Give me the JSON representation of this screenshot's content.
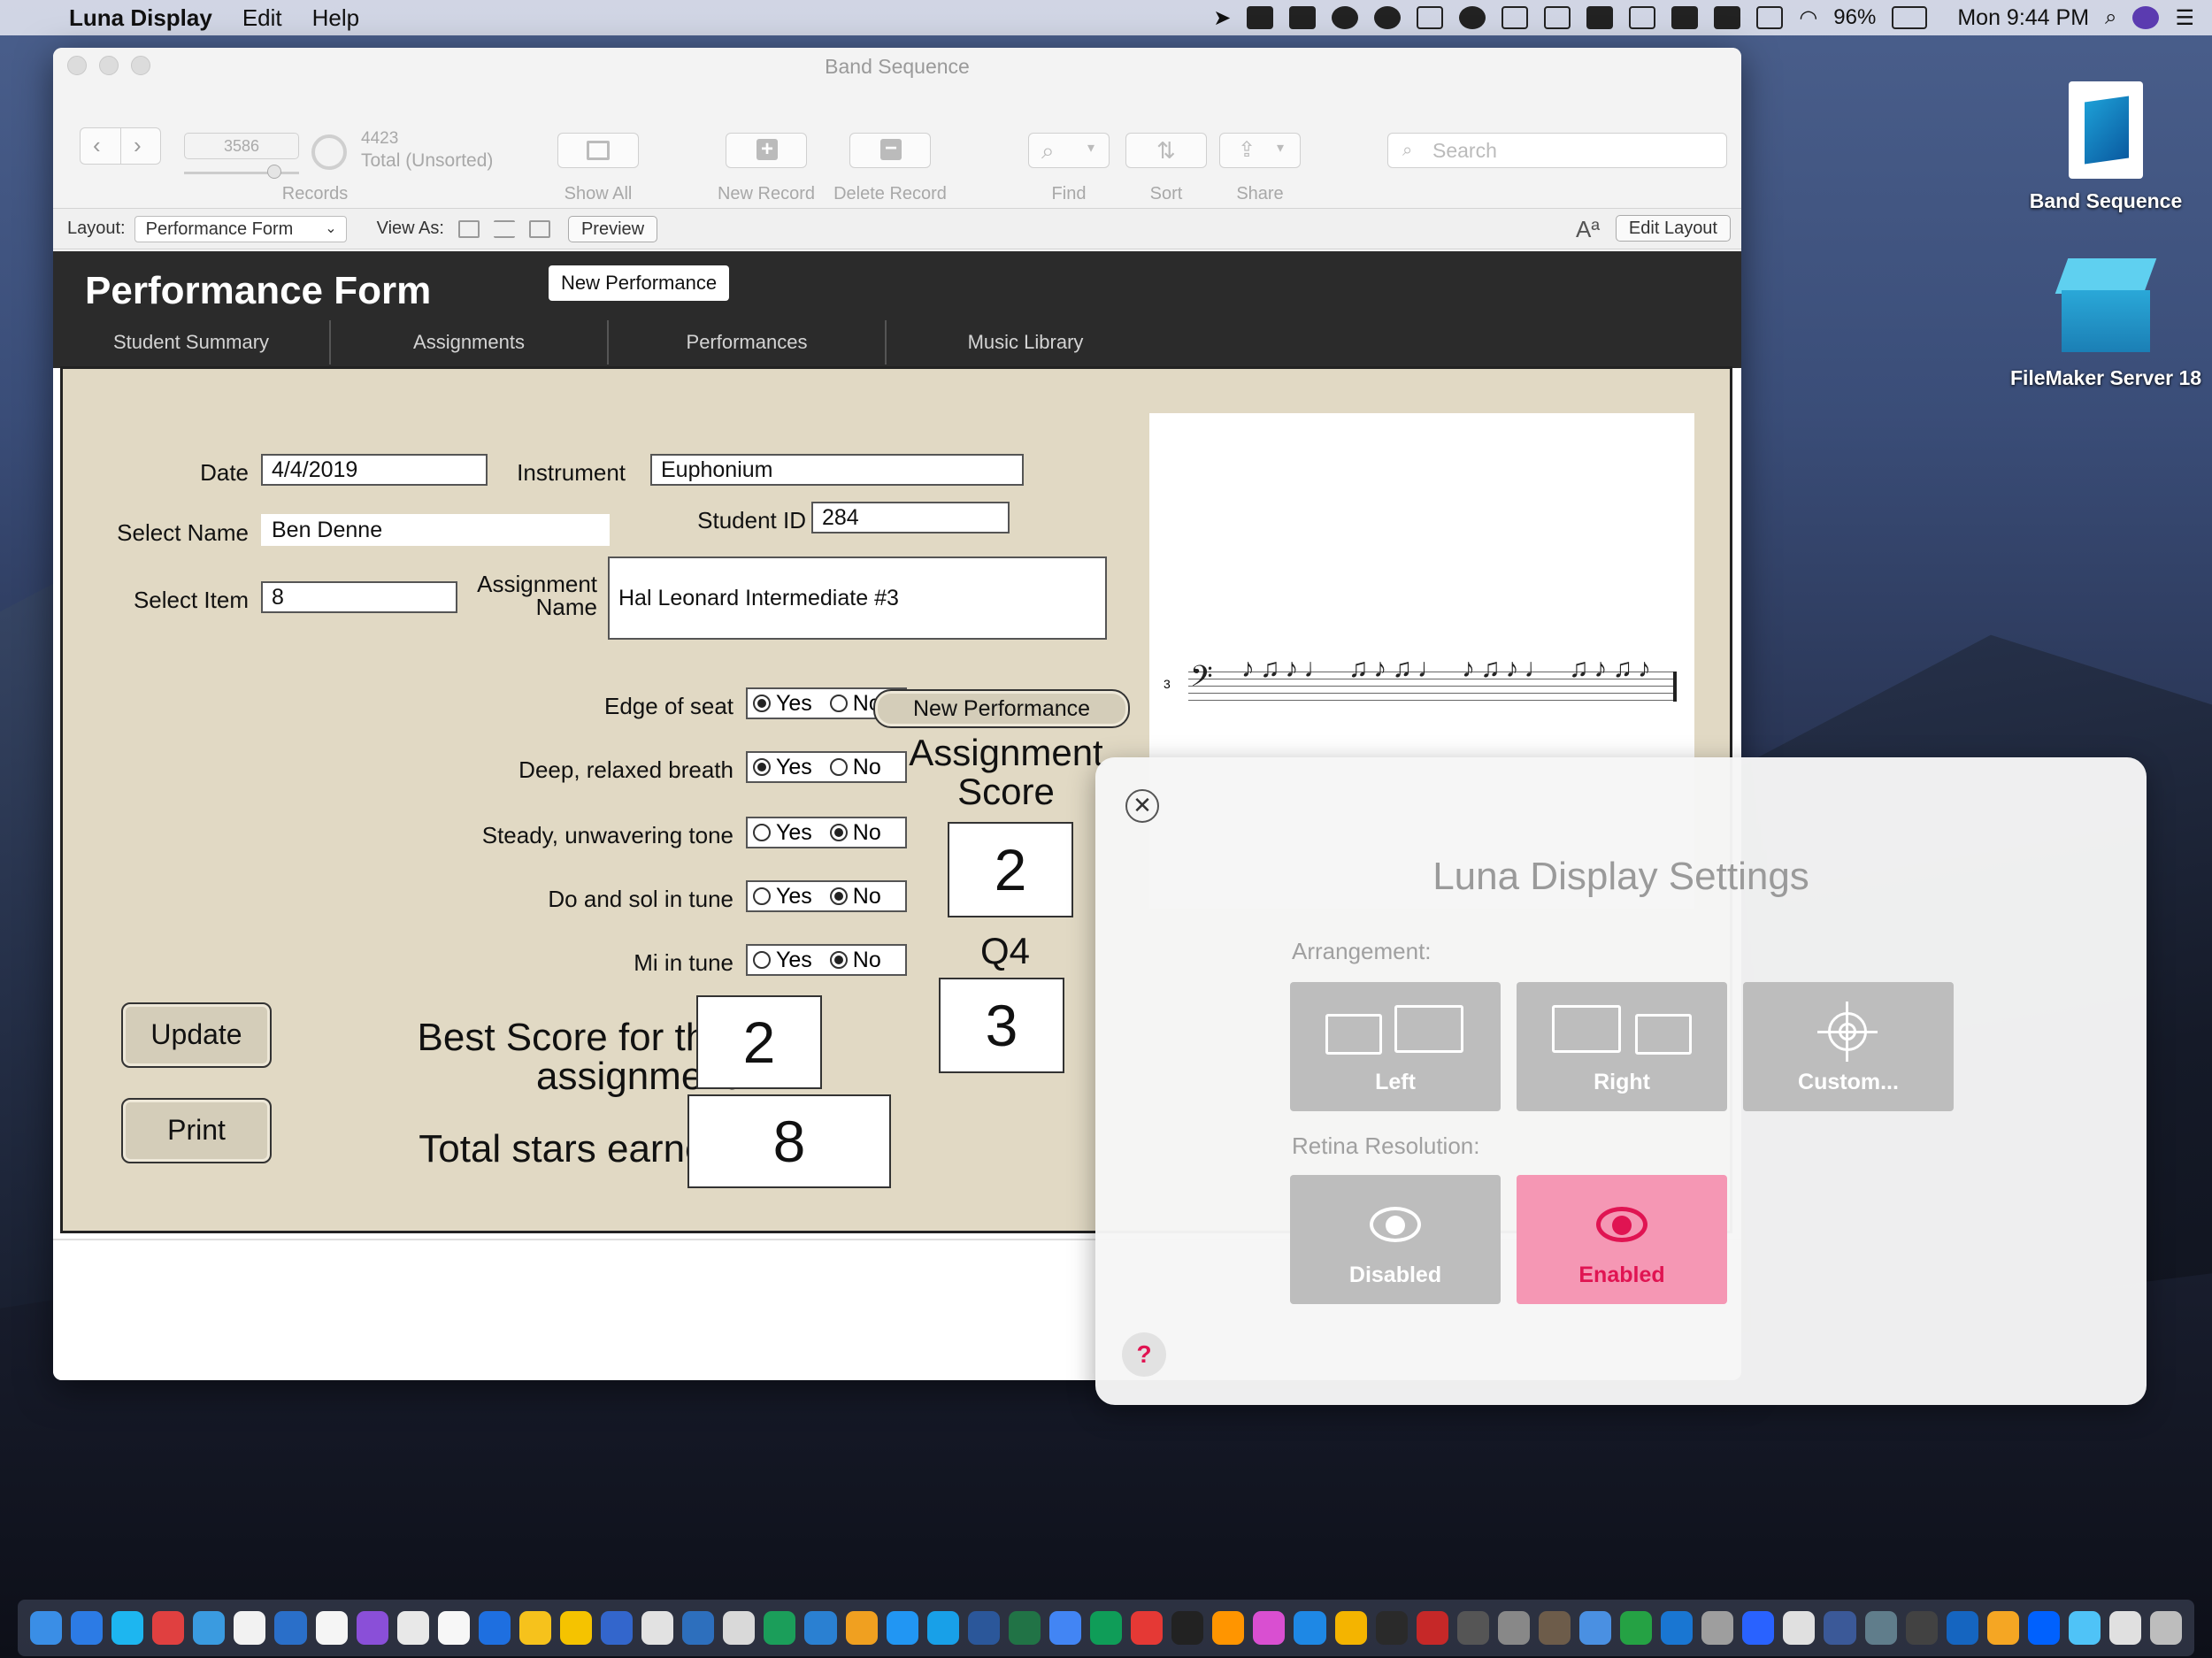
{
  "menubar": {
    "app_name": "Luna Display",
    "menus": [
      "Edit",
      "Help"
    ],
    "battery": "96%",
    "clock": "Mon 9:44 PM"
  },
  "window": {
    "title": "Band Sequence",
    "toolbar": {
      "record_current": "3586",
      "record_total": "4423",
      "total_status": "Total (Unsorted)",
      "records_label": "Records",
      "show_all": "Show All",
      "new_record": "New Record",
      "delete_record": "Delete Record",
      "find": "Find",
      "sort": "Sort",
      "share": "Share",
      "search_placeholder": "Search"
    },
    "layoutbar": {
      "layout_label": "Layout:",
      "layout_value": "Performance Form",
      "view_as_label": "View As:",
      "preview": "Preview",
      "edit_layout": "Edit Layout"
    }
  },
  "form": {
    "title": "Performance Form",
    "new_performance_top": "New Performance",
    "tabs": [
      "Student Summary",
      "Assignments",
      "Performances",
      "Music Library"
    ],
    "fields": {
      "date_label": "Date",
      "date_value": "4/4/2019",
      "instrument_label": "Instrument",
      "instrument_value": "Euphonium",
      "select_name_label": "Select Name",
      "select_name_value": "Ben Denne",
      "student_id_label": "Student ID",
      "student_id_value": "284",
      "select_item_label": "Select Item",
      "select_item_value": "8",
      "assignment_name_label": "Assignment Name",
      "assignment_name_value": "Hal Leonard Intermediate #3"
    },
    "criteria": [
      {
        "label": "Edge of seat",
        "yes": "Yes",
        "no": "No",
        "selected": "yes"
      },
      {
        "label": "Deep, relaxed breath",
        "yes": "Yes",
        "no": "No",
        "selected": "yes"
      },
      {
        "label": "Steady, unwavering tone",
        "yes": "Yes",
        "no": "No",
        "selected": "no"
      },
      {
        "label": "Do and sol in tune",
        "yes": "Yes",
        "no": "No",
        "selected": "no"
      },
      {
        "label": "Mi in tune",
        "yes": "Yes",
        "no": "No",
        "selected": "no"
      }
    ],
    "new_performance_btn": "New Performance",
    "assignment_score_label": "Assignment Score",
    "assignment_score": "2",
    "q4_label": "Q4",
    "q4_value": "3",
    "best_score_label": "Best Score for this assignment",
    "best_score": "2",
    "total_stars_label": "Total stars earned",
    "total_stars": "8",
    "update_btn": "Update",
    "print_btn": "Print",
    "measure_number": "3"
  },
  "desktop": {
    "icons": [
      "Band Sequence",
      "FileMaker Server 18"
    ]
  },
  "luna": {
    "title": "Luna Display Settings",
    "arrangement_label": "Arrangement:",
    "arrangement_options": [
      "Left",
      "Right",
      "Custom..."
    ],
    "retina_label": "Retina Resolution:",
    "retina_options": [
      "Disabled",
      "Enabled"
    ],
    "retina_selected": "Enabled",
    "help": "?",
    "close": "✕",
    "accent": "#e01452"
  }
}
